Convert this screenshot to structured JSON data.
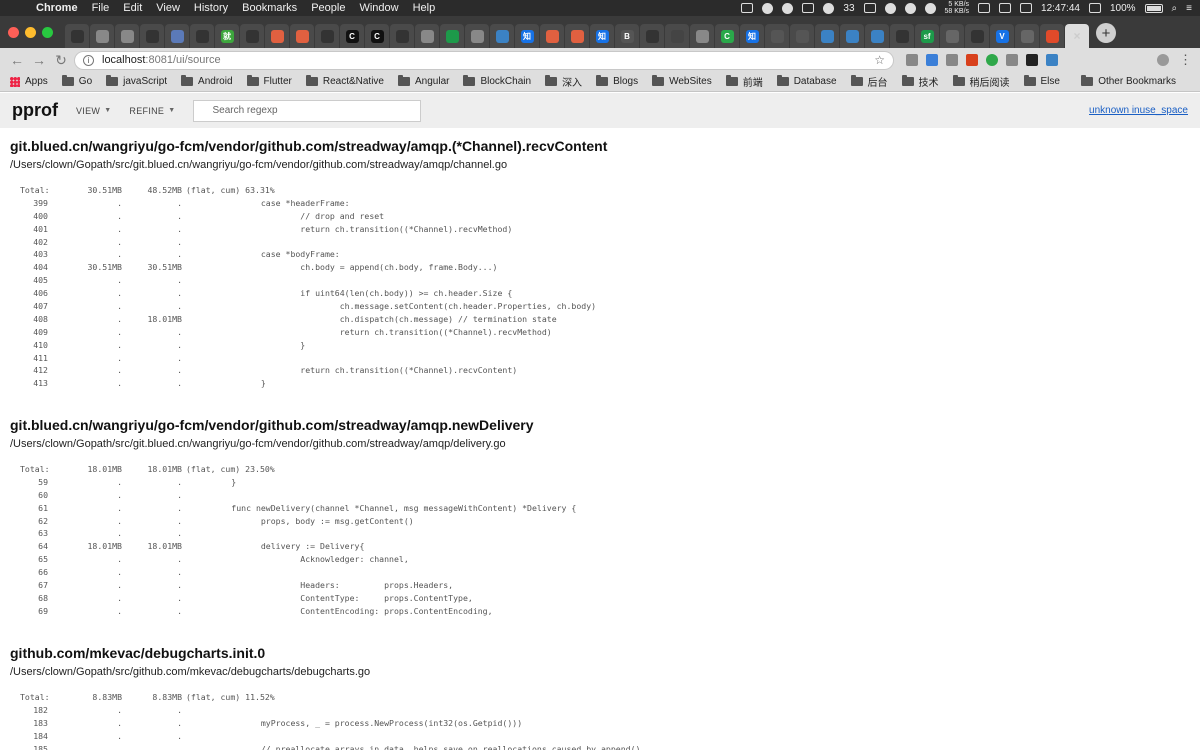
{
  "menubar": {
    "app": "Chrome",
    "items": [
      "File",
      "Edit",
      "View",
      "History",
      "Bookmarks",
      "People",
      "Window",
      "Help"
    ],
    "badge_count": "33",
    "net_up": "5 KB/s",
    "net_down": "58 KB/s",
    "time": "12:47:44",
    "battery": "100%"
  },
  "tabs": [
    {
      "label": "",
      "color": "#333333"
    },
    {
      "label": "",
      "color": "#888888"
    },
    {
      "label": "",
      "color": "#888888"
    },
    {
      "label": "",
      "color": "#333333"
    },
    {
      "label": "",
      "color": "#5b7ab8"
    },
    {
      "label": "",
      "color": "#333333"
    },
    {
      "label": "就",
      "color": "#3da63d"
    },
    {
      "label": "",
      "color": "#333333"
    },
    {
      "label": "",
      "color": "#e06040"
    },
    {
      "label": "",
      "color": "#e06040"
    },
    {
      "label": "",
      "color": "#333333"
    },
    {
      "label": "C",
      "color": "#111111"
    },
    {
      "label": "C",
      "color": "#111111"
    },
    {
      "label": "",
      "color": "#333333"
    },
    {
      "label": "",
      "color": "#888888"
    },
    {
      "label": "",
      "color": "#1d9a4a"
    },
    {
      "label": "",
      "color": "#888888"
    },
    {
      "label": "",
      "color": "#3b82c4"
    },
    {
      "label": "知",
      "color": "#1772e6"
    },
    {
      "label": "",
      "color": "#e06040"
    },
    {
      "label": "",
      "color": "#e06040"
    },
    {
      "label": "知",
      "color": "#1772e6"
    },
    {
      "label": "B",
      "color": "#555555"
    },
    {
      "label": "",
      "color": "#333333"
    },
    {
      "label": "",
      "color": "#444444"
    },
    {
      "label": "",
      "color": "#888888"
    },
    {
      "label": "C",
      "color": "#2aa84a"
    },
    {
      "label": "知",
      "color": "#1772e6"
    },
    {
      "label": "",
      "color": "#555555"
    },
    {
      "label": "",
      "color": "#555555"
    },
    {
      "label": "",
      "color": "#3b82c4"
    },
    {
      "label": "",
      "color": "#3b82c4"
    },
    {
      "label": "",
      "color": "#3b82c4"
    },
    {
      "label": "",
      "color": "#333333"
    },
    {
      "label": "sf",
      "color": "#1d9a4a"
    },
    {
      "label": "",
      "color": "#666666"
    },
    {
      "label": "",
      "color": "#333333"
    },
    {
      "label": "V",
      "color": "#1772e6"
    },
    {
      "label": "",
      "color": "#666666"
    },
    {
      "label": "",
      "color": "#e04a2a"
    }
  ],
  "url": {
    "host": "localhost",
    "path": ":8081/ui/source"
  },
  "bookmarks": {
    "apps": "Apps",
    "items": [
      "Go",
      "javaScript",
      "Android",
      "Flutter",
      "React&Native",
      "Angular",
      "BlockChain",
      "深入",
      "Blogs",
      "WebSites",
      "前端",
      "Database",
      "后台",
      "技术",
      "稍后阅读",
      "Else"
    ],
    "other": "Other Bookmarks"
  },
  "pprof": {
    "title": "pprof",
    "view": "VIEW",
    "refine": "REFINE",
    "search_placeholder": "Search regexp",
    "sample_link": "unknown inuse_space"
  },
  "sections": [
    {
      "func": "git.blued.cn/wangriyu/go-fcm/vendor/github.com/streadway/amqp.(*Channel).recvContent",
      "file": "/Users/clown/Gopath/src/git.blued.cn/wangriyu/go-fcm/vendor/github.com/streadway/amqp/channel.go",
      "total": {
        "label": "Total:",
        "flat": "30.51MB",
        "cum": "48.52MB",
        "pct": "(flat, cum) 63.31%"
      },
      "rows": [
        {
          "line": "399",
          "flat": ".",
          "cum": ".",
          "code": "                case *headerFrame:"
        },
        {
          "line": "400",
          "flat": ".",
          "cum": ".",
          "code": "                        // drop and reset"
        },
        {
          "line": "401",
          "flat": ".",
          "cum": ".",
          "code": "                        return ch.transition((*Channel).recvMethod)"
        },
        {
          "line": "402",
          "flat": ".",
          "cum": ".",
          "code": ""
        },
        {
          "line": "403",
          "flat": ".",
          "cum": ".",
          "code": "                case *bodyFrame:"
        },
        {
          "line": "404",
          "flat": "30.51MB",
          "cum": "30.51MB",
          "code": "                        ch.body = append(ch.body, frame.Body...)"
        },
        {
          "line": "405",
          "flat": ".",
          "cum": ".",
          "code": ""
        },
        {
          "line": "406",
          "flat": ".",
          "cum": ".",
          "code": "                        if uint64(len(ch.body)) >= ch.header.Size {"
        },
        {
          "line": "407",
          "flat": ".",
          "cum": ".",
          "code": "                                ch.message.setContent(ch.header.Properties, ch.body)"
        },
        {
          "line": "408",
          "flat": ".",
          "cum": "18.01MB",
          "code": "                                ch.dispatch(ch.message) // termination state"
        },
        {
          "line": "409",
          "flat": ".",
          "cum": ".",
          "code": "                                return ch.transition((*Channel).recvMethod)"
        },
        {
          "line": "410",
          "flat": ".",
          "cum": ".",
          "code": "                        }"
        },
        {
          "line": "411",
          "flat": ".",
          "cum": ".",
          "code": ""
        },
        {
          "line": "412",
          "flat": ".",
          "cum": ".",
          "code": "                        return ch.transition((*Channel).recvContent)"
        },
        {
          "line": "413",
          "flat": ".",
          "cum": ".",
          "code": "                }"
        }
      ]
    },
    {
      "func": "git.blued.cn/wangriyu/go-fcm/vendor/github.com/streadway/amqp.newDelivery",
      "file": "/Users/clown/Gopath/src/git.blued.cn/wangriyu/go-fcm/vendor/github.com/streadway/amqp/delivery.go",
      "total": {
        "label": "Total:",
        "flat": "18.01MB",
        "cum": "18.01MB",
        "pct": "(flat, cum) 23.50%"
      },
      "rows": [
        {
          "line": "59",
          "flat": ".",
          "cum": ".",
          "code": "          }"
        },
        {
          "line": "60",
          "flat": ".",
          "cum": ".",
          "code": ""
        },
        {
          "line": "61",
          "flat": ".",
          "cum": ".",
          "code": "          func newDelivery(channel *Channel, msg messageWithContent) *Delivery {"
        },
        {
          "line": "62",
          "flat": ".",
          "cum": ".",
          "code": "                props, body := msg.getContent()"
        },
        {
          "line": "63",
          "flat": ".",
          "cum": ".",
          "code": ""
        },
        {
          "line": "64",
          "flat": "18.01MB",
          "cum": "18.01MB",
          "code": "                delivery := Delivery{"
        },
        {
          "line": "65",
          "flat": ".",
          "cum": ".",
          "code": "                        Acknowledger: channel,"
        },
        {
          "line": "66",
          "flat": ".",
          "cum": ".",
          "code": ""
        },
        {
          "line": "67",
          "flat": ".",
          "cum": ".",
          "code": "                        Headers:         props.Headers,"
        },
        {
          "line": "68",
          "flat": ".",
          "cum": ".",
          "code": "                        ContentType:     props.ContentType,"
        },
        {
          "line": "69",
          "flat": ".",
          "cum": ".",
          "code": "                        ContentEncoding: props.ContentEncoding,"
        }
      ]
    },
    {
      "func": "github.com/mkevac/debugcharts.init.0",
      "file": "/Users/clown/Gopath/src/github.com/mkevac/debugcharts/debugcharts.go",
      "total": {
        "label": "Total:",
        "flat": "8.83MB",
        "cum": "8.83MB",
        "pct": "(flat, cum) 11.52%"
      },
      "rows": [
        {
          "line": "182",
          "flat": ".",
          "cum": ".",
          "code": ""
        },
        {
          "line": "183",
          "flat": ".",
          "cum": ".",
          "code": "                myProcess, _ = process.NewProcess(int32(os.Getpid()))"
        },
        {
          "line": "184",
          "flat": ".",
          "cum": ".",
          "code": ""
        },
        {
          "line": "185",
          "flat": ".",
          "cum": ".",
          "code": "                // preallocate arrays in data, helps save on reallocations caused by append()"
        }
      ]
    }
  ]
}
